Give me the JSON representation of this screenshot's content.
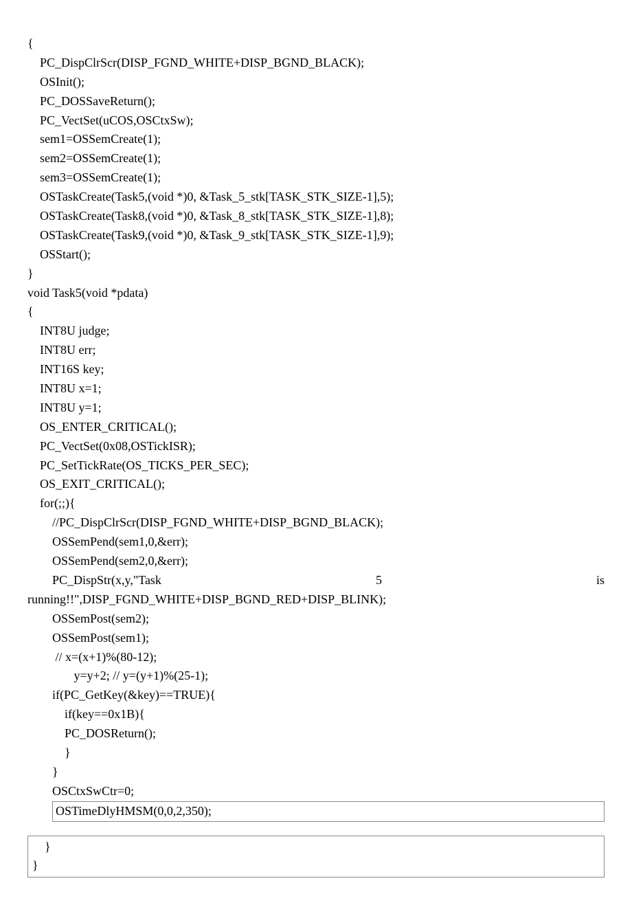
{
  "code": {
    "l1": "{",
    "l2": "    PC_DispClrScr(DISP_FGND_WHITE+DISP_BGND_BLACK);",
    "l3": "    OSInit();",
    "l4": "    PC_DOSSaveReturn();",
    "l5": "    PC_VectSet(uCOS,OSCtxSw);",
    "l6": "    sem1=OSSemCreate(1);",
    "l7": "    sem2=OSSemCreate(1);",
    "l8": "    sem3=OSSemCreate(1);",
    "l9": "    OSTaskCreate(Task5,(void *)0, &Task_5_stk[TASK_STK_SIZE-1],5);",
    "l10": "    OSTaskCreate(Task8,(void *)0, &Task_8_stk[TASK_STK_SIZE-1],8);",
    "l11": "    OSTaskCreate(Task9,(void *)0, &Task_9_stk[TASK_STK_SIZE-1],9);",
    "l12": "    OSStart();",
    "l13": "}",
    "l14": "void Task5(void *pdata)",
    "l15": "{",
    "l16": "",
    "l17": "    INT8U judge;",
    "l18": "    INT8U err;",
    "l19": "    INT16S key;",
    "l20": "    INT8U x=1;",
    "l21": "    INT8U y=1;",
    "l22": "    OS_ENTER_CRITICAL();",
    "l23": "    PC_VectSet(0x08,OSTickISR);",
    "l24": "    PC_SetTickRate(OS_TICKS_PER_SEC);",
    "l25": "",
    "l26": "",
    "l27": "    OS_EXIT_CRITICAL();",
    "l28": "    for(;;){",
    "l29": "",
    "l30": "        //PC_DispClrScr(DISP_FGND_WHITE+DISP_BGND_BLACK);",
    "l31": "        OSSemPend(sem1,0,&err);",
    "l32": "        OSSemPend(sem2,0,&err);",
    "j1a": "        PC_DispStr(x,y,\"Task",
    "j1b": "5",
    "j1c": "is",
    "l34": "running!!\",DISP_FGND_WHITE+DISP_BGND_RED+DISP_BLINK);",
    "l35": "        OSSemPost(sem2);",
    "l36": "        OSSemPost(sem1);",
    "l37": "         // x=(x+1)%(80-12);",
    "l38": "               y=y+2; // y=(y+1)%(25-1);",
    "l39": "        if(PC_GetKey(&key)==TRUE){",
    "l40": "            if(key==0x1B){",
    "l41": "            PC_DOSReturn();",
    "l42": "            }",
    "l43": "        }",
    "l44": "        OSCtxSwCtr=0;",
    "l45_pre": "        ",
    "l45_box": "OSTimeDlyHMSM(0,0,2,350);",
    "b1": "    }",
    "b2": "}"
  }
}
